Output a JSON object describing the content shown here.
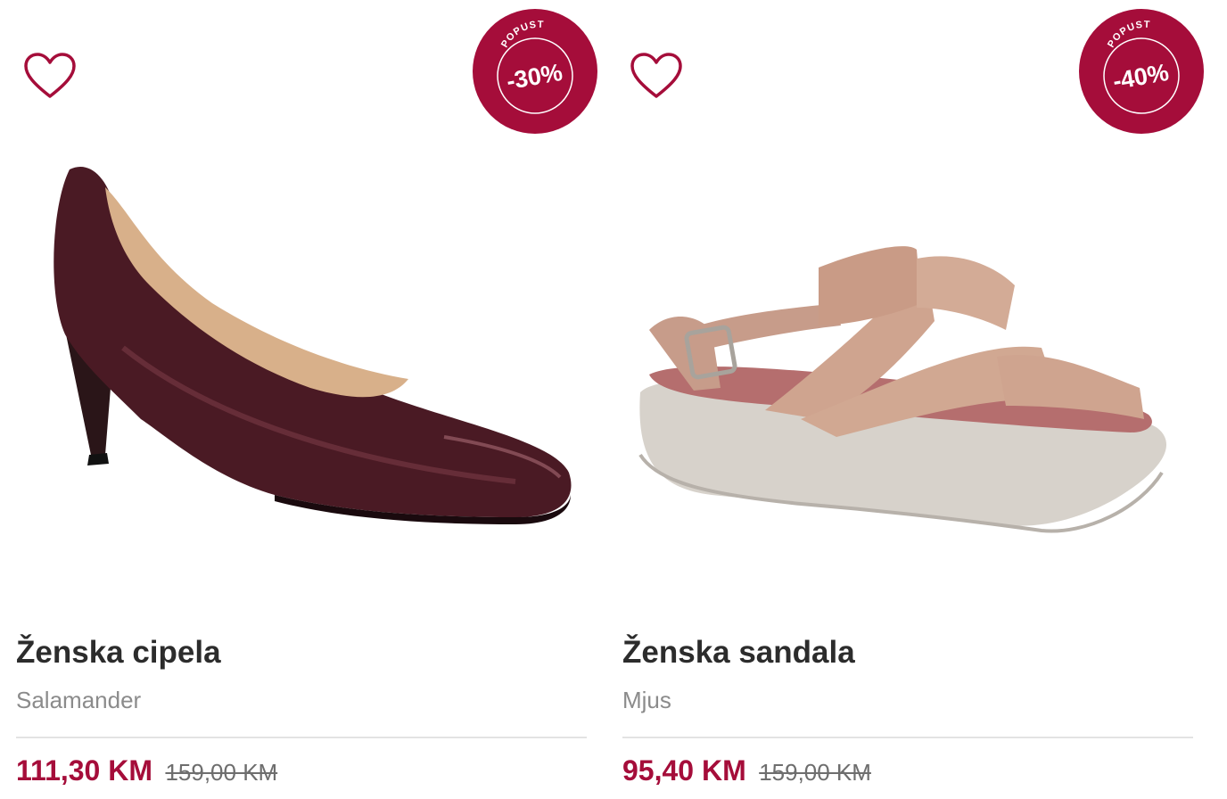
{
  "colors": {
    "accent": "#a50d3a",
    "text": "#2c2c2c",
    "muted": "#8b8b8b"
  },
  "products": [
    {
      "name": "Ženska cipela",
      "brand": "Salamander",
      "price": "111,30 KM",
      "old_price": "159,00 KM",
      "badge_label": "POPUST",
      "discount": "-30%",
      "image": "burgundy-patent-pump",
      "favorite_icon": "heart-outline-icon"
    },
    {
      "name": "Ženska sandala",
      "brand": "Mjus",
      "price": "95,40 KM",
      "old_price": "159,00 KM",
      "badge_label": "POPUST",
      "discount": "-40%",
      "image": "beige-platform-sandal",
      "favorite_icon": "heart-outline-icon"
    }
  ]
}
